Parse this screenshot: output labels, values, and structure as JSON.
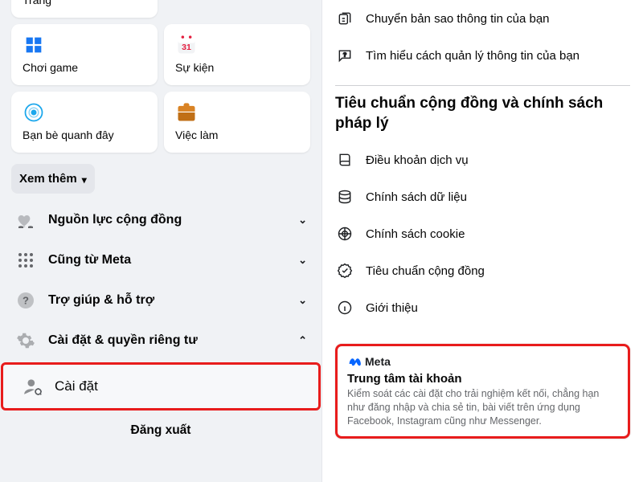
{
  "left": {
    "partial_card_label": "Trang",
    "shortcuts": [
      {
        "label": "Chơi game",
        "icon": "game"
      },
      {
        "label": "Sự kiện",
        "icon": "calendar"
      },
      {
        "label": "Bạn bè quanh đây",
        "icon": "nearby"
      },
      {
        "label": "Việc làm",
        "icon": "briefcase"
      }
    ],
    "see_more": "Xem thêm",
    "rows": [
      {
        "label": "Nguồn lực cộng đồng",
        "icon": "heart-hands",
        "expanded": false
      },
      {
        "label": "Cũng từ Meta",
        "icon": "grid",
        "expanded": false
      },
      {
        "label": "Trợ giúp & hỗ trợ",
        "icon": "help",
        "expanded": false
      },
      {
        "label": "Cài đặt & quyền riêng tư",
        "icon": "gear",
        "expanded": true
      }
    ],
    "sub_row": {
      "label": "Cài đặt",
      "icon": "person-gear"
    },
    "logout": "Đăng xuất"
  },
  "right": {
    "top_rows": [
      {
        "label": "Chuyển bản sao thông tin của bạn",
        "icon": "transfer"
      },
      {
        "label": "Tìm hiểu cách quản lý thông tin của bạn",
        "icon": "question-bubble"
      }
    ],
    "heading": "Tiêu chuẩn cộng đồng và chính sách pháp lý",
    "policy_rows": [
      {
        "label": "Điều khoản dịch vụ",
        "icon": "book"
      },
      {
        "label": "Chính sách dữ liệu",
        "icon": "data"
      },
      {
        "label": "Chính sách cookie",
        "icon": "cookie"
      },
      {
        "label": "Tiêu chuẩn cộng đồng",
        "icon": "badge-check"
      },
      {
        "label": "Giới thiệu",
        "icon": "info"
      }
    ],
    "meta_card": {
      "brand": "Meta",
      "title": "Trung tâm tài khoản",
      "desc": "Kiểm soát các cài đặt cho trải nghiệm kết nối, chẳng hạn như đăng nhập và chia sẻ tin, bài viết trên ứng dụng Facebook, Instagram cũng như Messenger."
    }
  }
}
